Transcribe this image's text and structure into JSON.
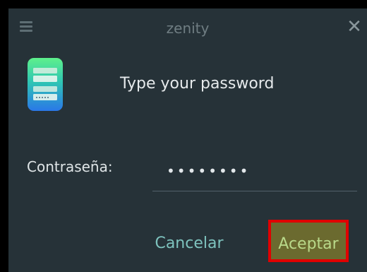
{
  "window": {
    "title": "zenity",
    "menu_icon": "hamburger-menu-icon",
    "close_icon": "close-icon",
    "close_glyph": "✕"
  },
  "dialog": {
    "icon": "password-dialog-icon",
    "prompt": "Type your password"
  },
  "form": {
    "password_label": "Contraseña:",
    "password_value_masked": "••••••••"
  },
  "buttons": {
    "cancel_label": "Cancelar",
    "accept_label": "Aceptar"
  },
  "colors": {
    "background": "#263238",
    "accent_cancel": "#7ec3be",
    "accept_fill": "#6b6a2f",
    "highlight_border": "#e00000"
  }
}
